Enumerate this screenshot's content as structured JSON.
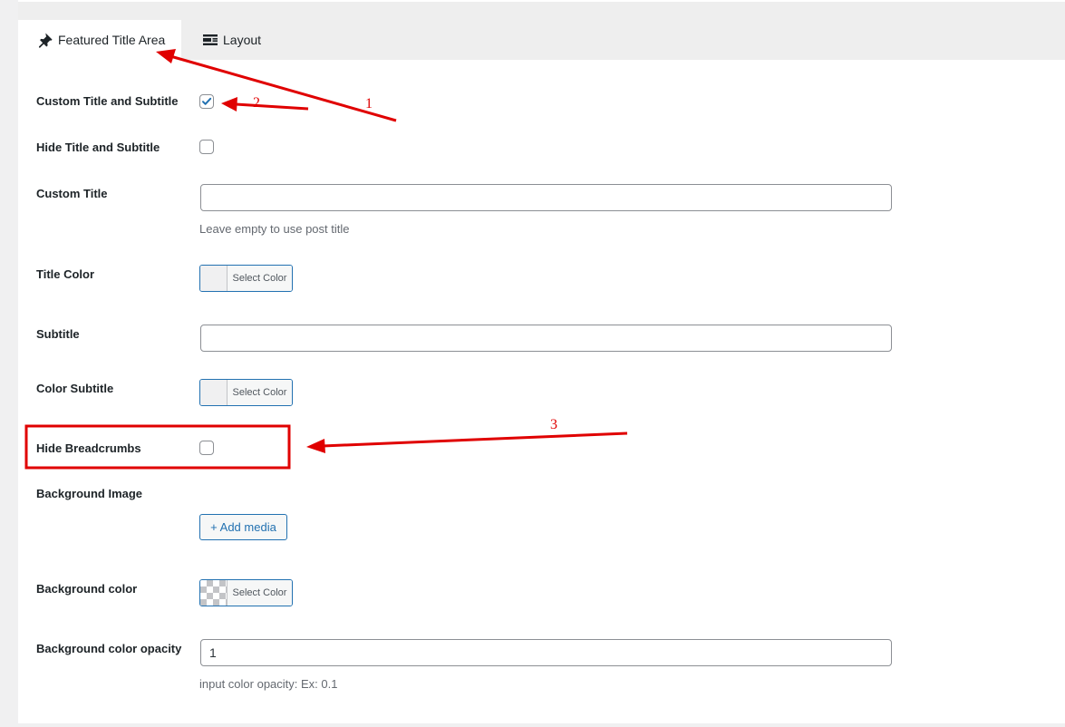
{
  "tabs": [
    {
      "label": "Featured Title Area",
      "icon": "pin-icon",
      "active": true
    },
    {
      "label": "Layout",
      "icon": "layout-icon",
      "active": false
    }
  ],
  "fields": {
    "custom_title_subtitle": {
      "label": "Custom Title and Subtitle",
      "checked": true
    },
    "hide_title_subtitle": {
      "label": "Hide Title and Subtitle",
      "checked": false
    },
    "custom_title": {
      "label": "Custom Title",
      "value": "",
      "hint": "Leave empty to use post title"
    },
    "title_color": {
      "label": "Title Color",
      "button": "Select Color"
    },
    "subtitle": {
      "label": "Subtitle",
      "value": ""
    },
    "color_subtitle": {
      "label": "Color Subtitle",
      "button": "Select Color"
    },
    "hide_breadcrumbs": {
      "label": "Hide Breadcrumbs",
      "checked": false
    },
    "background_image": {
      "label": "Background Image",
      "button": "+ Add media"
    },
    "background_color": {
      "label": "Background color",
      "button": "Select Color"
    },
    "background_opacity": {
      "label": "Background color opacity",
      "value": "1",
      "hint": "input color opacity: Ex: 0.1"
    }
  },
  "annotations": {
    "arrow_1": "1",
    "arrow_2": "2",
    "arrow_3": "3",
    "color": "#e00000"
  },
  "colors": {
    "accent": "#2271b1",
    "border": "#8c8f94",
    "background": "#f0f0f1"
  }
}
